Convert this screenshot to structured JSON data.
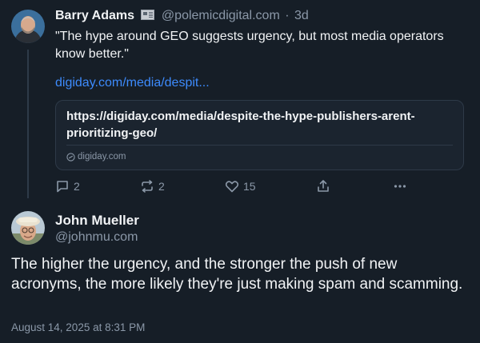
{
  "parent_post": {
    "author_name": "Barry Adams",
    "author_handle": "@polemicdigital.com",
    "separator": "·",
    "time": "3d",
    "text": "\"The hype around GEO suggests urgency, but most media operators know better.\"",
    "link_text": "digiday.com/media/despit...",
    "card": {
      "url": "https://digiday.com/media/despite-the-hype-publishers-arent-prioritizing-geo/",
      "domain": "digiday.com"
    },
    "actions": {
      "replies": "2",
      "reposts": "2",
      "likes": "15"
    }
  },
  "main_post": {
    "author_name": "John Mueller",
    "author_handle": "@johnmu.com",
    "text": "The higher the urgency, and the stronger the push of new acronyms, the more likely they're just making spam and scamming.",
    "timestamp": "August 14, 2025 at 8:31 PM"
  },
  "colors": {
    "background": "#161e27",
    "text_primary": "#f1f3f5",
    "text_secondary": "#8b98a8",
    "link": "#3d8bfd",
    "border": "#2e3a48"
  }
}
